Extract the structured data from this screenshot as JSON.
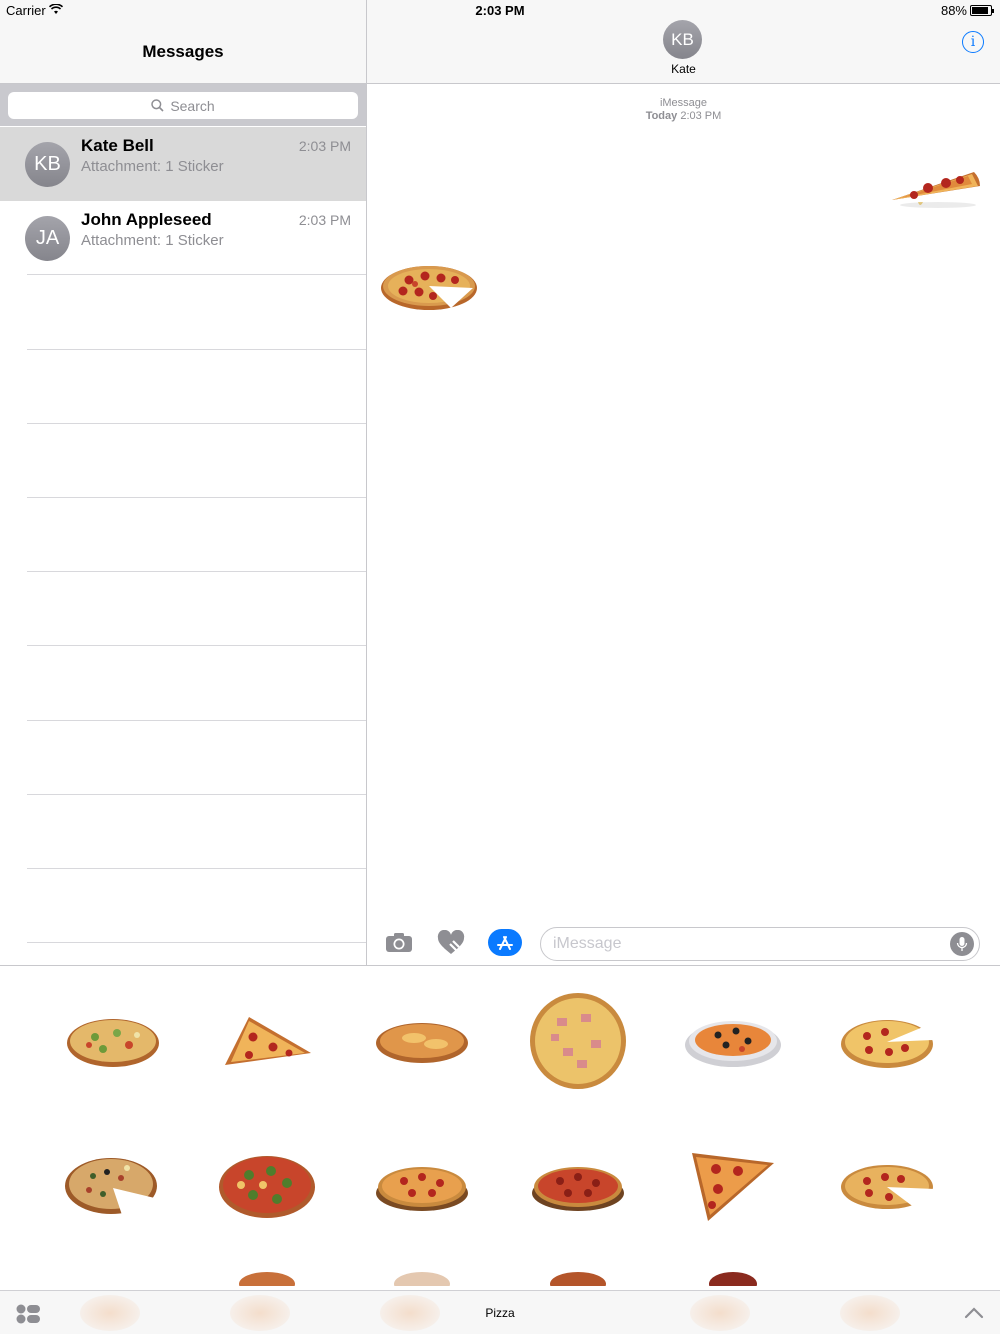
{
  "status_bar": {
    "carrier": "Carrier",
    "time": "2:03 PM",
    "battery": "88%"
  },
  "sidebar": {
    "title": "Messages",
    "search_placeholder": "Search",
    "conversations": [
      {
        "initials": "KB",
        "name": "Kate Bell",
        "preview": "Attachment: 1 Sticker",
        "time": "2:03 PM",
        "selected": true
      },
      {
        "initials": "JA",
        "name": "John Appleseed",
        "preview": "Attachment: 1 Sticker",
        "time": "2:03 PM",
        "selected": false
      }
    ]
  },
  "conversation": {
    "contact_initials": "KB",
    "contact_name": "Kate",
    "service": "iMessage",
    "timestamp_day": "Today",
    "timestamp_time": "2:03 PM",
    "messages": [
      {
        "direction": "outgoing",
        "content": "pizza-slice-sticker"
      },
      {
        "direction": "incoming",
        "content": "pepperoni-pizza-sticker"
      }
    ]
  },
  "input": {
    "placeholder": "iMessage"
  },
  "drawer": {
    "title": "Pizza",
    "stickers": [
      "veggie-pizza",
      "pizza-slice",
      "cheese-pizza",
      "hawaiian-pizza",
      "olive-pizza-plate",
      "pepperoni-pizza-cut",
      "supreme-pizza-cut",
      "broccoli-pizza",
      "pepperoni-pizza-board",
      "sausage-pizza",
      "pepperoni-slice",
      "pepperoni-pizza-missing-slice"
    ]
  },
  "colors": {
    "accent": "#0a7aff",
    "selected_row": "#d9d9d9",
    "crust": "#d99a4e",
    "sauce": "#c8452b",
    "cheese": "#f2c26b",
    "pepperoni": "#b3261e"
  }
}
